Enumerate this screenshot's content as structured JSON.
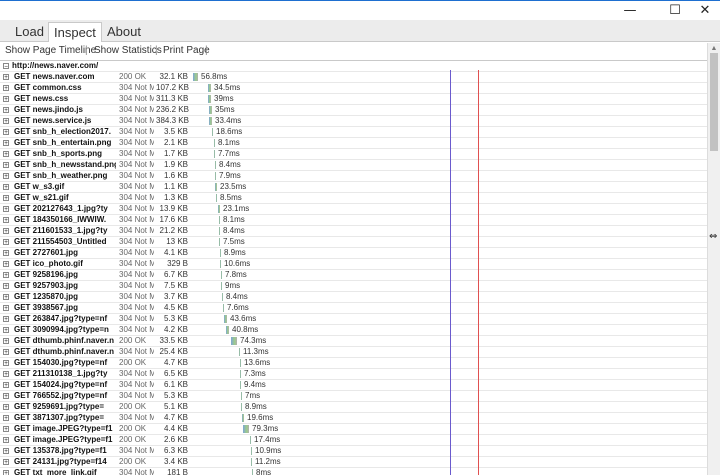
{
  "window": {
    "minimize": "—",
    "maximize": "☐",
    "close": "✕"
  },
  "tabs": [
    {
      "label": "Load"
    },
    {
      "label": "Inspect"
    },
    {
      "label": "About"
    }
  ],
  "toolbar": {
    "show_timeline": "Show Page Timeline",
    "show_statistics": "Show Statistics",
    "print_page": "Print Page",
    "separator": "|"
  },
  "root": {
    "expander": "−",
    "url": "http://news.naver.com/"
  },
  "colors": {
    "blue_line": "#6a5acd",
    "red_line": "#e05050",
    "bar": "#8fbc8f"
  },
  "requests": [
    {
      "name": "GET news.naver.com",
      "status": "200 OK",
      "size": "32.1 KB",
      "time": "56.8ms",
      "start": 0.0,
      "ms": 56.8
    },
    {
      "name": "GET common.css",
      "status": "304 Not M",
      "size": "107.2 KB",
      "time": "34.5ms",
      "start": 15,
      "ms": 34.5
    },
    {
      "name": "GET news.css",
      "status": "304 Not M",
      "size": "311.3 KB",
      "time": "39ms",
      "start": 15,
      "ms": 39
    },
    {
      "name": "GET news.jindo.js",
      "status": "304 Not M",
      "size": "236.2 KB",
      "time": "35ms",
      "start": 16,
      "ms": 35
    },
    {
      "name": "GET news.service.js",
      "status": "304 Not M",
      "size": "384.3 KB",
      "time": "33.4ms",
      "start": 16,
      "ms": 33.4
    },
    {
      "name": "GET snb_h_election2017.",
      "status": "304 Not M",
      "size": "3.5 KB",
      "time": "18.6ms",
      "start": 19,
      "ms": 18.6
    },
    {
      "name": "GET snb_h_entertain.png",
      "status": "304 Not M",
      "size": "2.1 KB",
      "time": "8.1ms",
      "start": 21,
      "ms": 8.1
    },
    {
      "name": "GET snb_h_sports.png",
      "status": "304 Not M",
      "size": "1.7 KB",
      "time": "7.7ms",
      "start": 21,
      "ms": 7.7
    },
    {
      "name": "GET snb_h_newsstand.png",
      "status": "304 Not M",
      "size": "1.9 KB",
      "time": "8.4ms",
      "start": 22,
      "ms": 8.4
    },
    {
      "name": "GET snb_h_weather.png",
      "status": "304 Not M",
      "size": "1.6 KB",
      "time": "7.9ms",
      "start": 22,
      "ms": 7.9
    },
    {
      "name": "GET w_s3.gif",
      "status": "304 Not M",
      "size": "1.1 KB",
      "time": "23.5ms",
      "start": 22,
      "ms": 23.5
    },
    {
      "name": "GET w_s21.gif",
      "status": "304 Not M",
      "size": "1.3 KB",
      "time": "8.5ms",
      "start": 23,
      "ms": 8.5
    },
    {
      "name": "GET 202127643_1.jpg?ty",
      "status": "304 Not M",
      "size": "13.9 KB",
      "time": "23.1ms",
      "start": 25,
      "ms": 23.1
    },
    {
      "name": "GET 184350166_IWWIW.",
      "status": "304 Not M",
      "size": "17.6 KB",
      "time": "8.1ms",
      "start": 26,
      "ms": 8.1
    },
    {
      "name": "GET 211601533_1.jpg?ty",
      "status": "304 Not M",
      "size": "21.2 KB",
      "time": "8.4ms",
      "start": 26,
      "ms": 8.4
    },
    {
      "name": "GET 211554503_Untitled",
      "status": "304 Not M",
      "size": "13 KB",
      "time": "7.5ms",
      "start": 26,
      "ms": 7.5
    },
    {
      "name": "GET 2727601.jpg",
      "status": "304 Not M",
      "size": "4.1 KB",
      "time": "8.9ms",
      "start": 27,
      "ms": 8.9
    },
    {
      "name": "GET ico_photo.gif",
      "status": "304 Not M",
      "size": "329 B",
      "time": "10.6ms",
      "start": 27,
      "ms": 10.6
    },
    {
      "name": "GET 9258196.jpg",
      "status": "304 Not M",
      "size": "6.7 KB",
      "time": "7.8ms",
      "start": 28,
      "ms": 7.8
    },
    {
      "name": "GET 9257903.jpg",
      "status": "304 Not M",
      "size": "7.5 KB",
      "time": "9ms",
      "start": 28,
      "ms": 9
    },
    {
      "name": "GET 1235870.jpg",
      "status": "304 Not M",
      "size": "3.7 KB",
      "time": "8.4ms",
      "start": 29,
      "ms": 8.4
    },
    {
      "name": "GET 3938567.jpg",
      "status": "304 Not M",
      "size": "4.5 KB",
      "time": "7.6ms",
      "start": 30,
      "ms": 7.6
    },
    {
      "name": "GET 263847.jpg?type=nf",
      "status": "304 Not M",
      "size": "5.3 KB",
      "time": "43.6ms",
      "start": 31,
      "ms": 43.6
    },
    {
      "name": "GET 3090994.jpg?type=n",
      "status": "304 Not M",
      "size": "4.2 KB",
      "time": "40.8ms",
      "start": 33,
      "ms": 40.8
    },
    {
      "name": "GET dthumb.phinf.naver.n",
      "status": "200 OK",
      "size": "33.5 KB",
      "time": "74.3ms",
      "start": 38,
      "ms": 74.3
    },
    {
      "name": "GET dthumb.phinf.naver.n",
      "status": "304 Not M",
      "size": "25.4 KB",
      "time": "11.3ms",
      "start": 46,
      "ms": 11.3
    },
    {
      "name": "GET 154030.jpg?type=nf",
      "status": "200 OK",
      "size": "4.7 KB",
      "time": "13.6ms",
      "start": 47,
      "ms": 13.6
    },
    {
      "name": "GET 211310138_1.jpg?ty",
      "status": "304 Not M",
      "size": "6.5 KB",
      "time": "7.3ms",
      "start": 47,
      "ms": 7.3
    },
    {
      "name": "GET 154024.jpg?type=nf",
      "status": "304 Not M",
      "size": "6.1 KB",
      "time": "9.4ms",
      "start": 47,
      "ms": 9.4
    },
    {
      "name": "GET 766552.jpg?type=nf",
      "status": "304 Not M",
      "size": "5.3 KB",
      "time": "7ms",
      "start": 48,
      "ms": 7
    },
    {
      "name": "GET 9259691.jpg?type=",
      "status": "200 OK",
      "size": "5.1 KB",
      "time": "8.9ms",
      "start": 48,
      "ms": 8.9
    },
    {
      "name": "GET 3871307.jpg?type=",
      "status": "304 Not M",
      "size": "4.7 KB",
      "time": "19.6ms",
      "start": 49,
      "ms": 19.6
    },
    {
      "name": "GET image.JPEG?type=f1",
      "status": "200 OK",
      "size": "4.4 KB",
      "time": "79.3ms",
      "start": 50,
      "ms": 79.3
    },
    {
      "name": "GET image.JPEG?type=f1",
      "status": "200 OK",
      "size": "2.6 KB",
      "time": "17.4ms",
      "start": 57,
      "ms": 17.4
    },
    {
      "name": "GET 135378.jpg?type=f1",
      "status": "304 Not M",
      "size": "6.3 KB",
      "time": "10.9ms",
      "start": 58,
      "ms": 10.9
    },
    {
      "name": "GET 24131.jpg?type=f14",
      "status": "200 OK",
      "size": "3.4 KB",
      "time": "11.2ms",
      "start": 58,
      "ms": 11.2
    },
    {
      "name": "GET txt_more_link.gif",
      "status": "304 Not M",
      "size": "181 B",
      "time": "8ms",
      "start": 59,
      "ms": 8
    }
  ]
}
